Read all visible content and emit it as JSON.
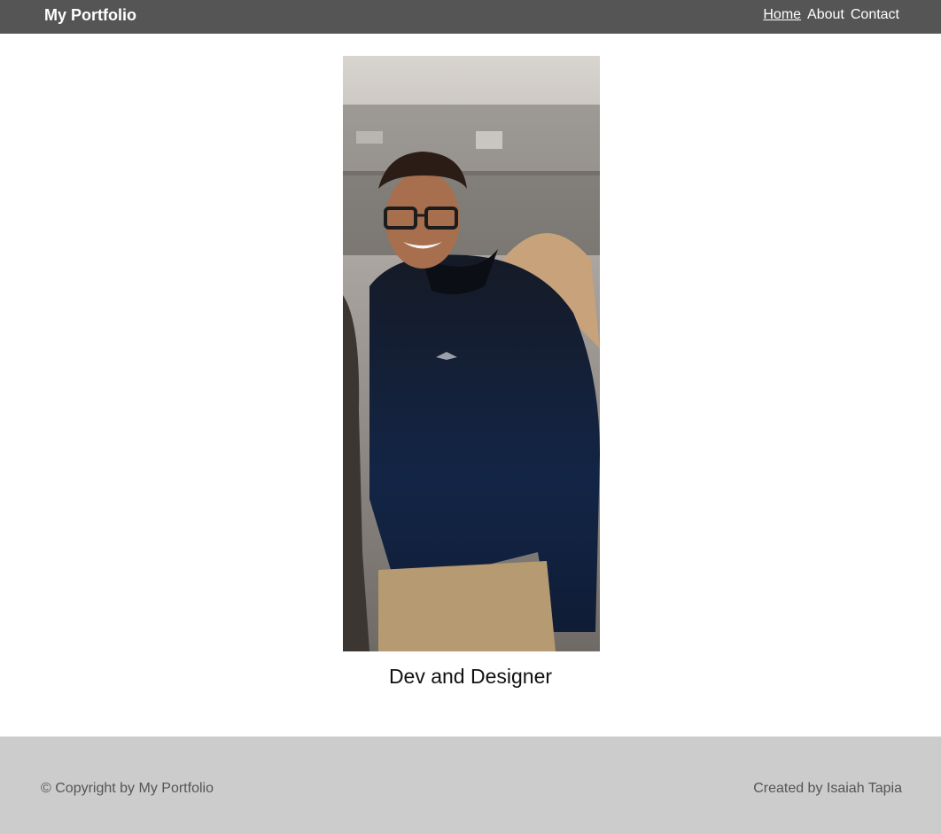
{
  "navbar": {
    "brand": "My Portfolio",
    "links": [
      {
        "label": "Home",
        "active": true
      },
      {
        "label": "About",
        "active": false
      },
      {
        "label": "Contact",
        "active": false
      }
    ],
    "background": "#555555"
  },
  "hero": {
    "photo_icon": "profile-photo",
    "tagline": "Dev and Designer"
  },
  "footer": {
    "copyright": "© Copyright by My Portfolio",
    "credit": "Created by Isaiah Tapia",
    "background": "#cccccc"
  }
}
